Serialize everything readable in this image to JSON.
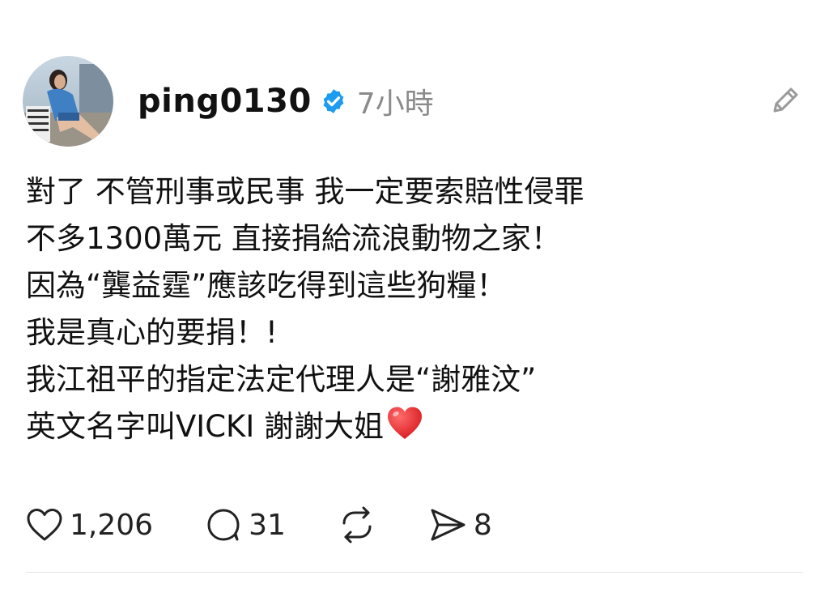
{
  "post": {
    "author": {
      "username": "ping0130",
      "verified": true,
      "avatar_icon": "profile-photo"
    },
    "timestamp": "7小時",
    "body_lines": [
      "對了 不管刑事或民事 我一定要索賠性侵罪",
      "不多1300萬元 直接捐給流浪動物之家！",
      "因為“龔益霆”應該吃得到這些狗糧！",
      "我是真心的要捐！!",
      "我江祖平的指定法定代理人是“謝雅汶”",
      "英文名字叫VICKI  謝謝大姐"
    ],
    "trailing_emoji": "red-heart-icon",
    "actions": {
      "like_count": "1,206",
      "comment_count": "31",
      "repost_count": "",
      "share_count": "8"
    }
  },
  "colors": {
    "text": "#111111",
    "muted": "#8a8a8a",
    "verified_badge": "#1d9bf0",
    "heart_emoji": "#e0242b",
    "divider": "#e2e2e2"
  }
}
